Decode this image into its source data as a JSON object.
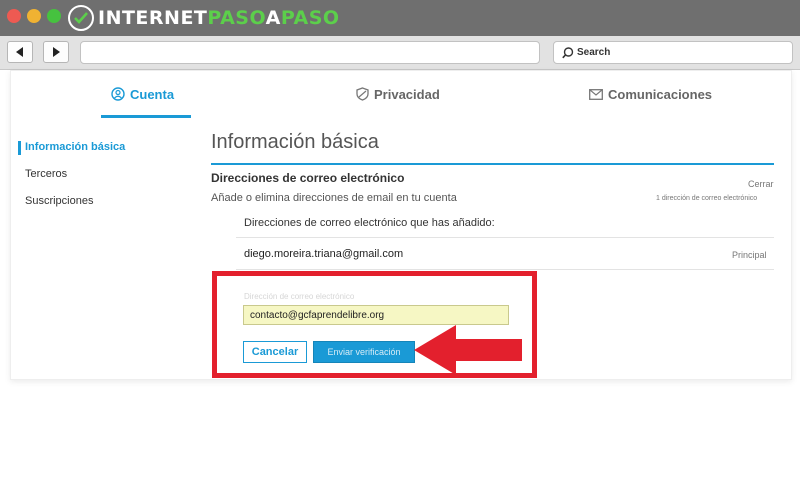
{
  "browser": {
    "logo": {
      "part1": "INTERNET",
      "part2": "PASO",
      "part3": "A",
      "part4": "PASO"
    },
    "search_placeholder": "Search"
  },
  "tabs": [
    {
      "label": "Cuenta",
      "icon": "user-circle-icon",
      "active": true
    },
    {
      "label": "Privacidad",
      "icon": "shield-icon",
      "active": false
    },
    {
      "label": "Comunicaciones",
      "icon": "envelope-icon",
      "active": false
    }
  ],
  "sidebar": {
    "items": [
      {
        "label": "Información básica",
        "active": true
      },
      {
        "label": "Terceros",
        "active": false
      },
      {
        "label": "Suscripciones",
        "active": false
      }
    ]
  },
  "main": {
    "title": "Información básica",
    "section": {
      "heading": "Direcciones de correo electrónico",
      "close_label": "Cerrar",
      "description": "Añade o elimina direcciones de email en tu cuenta",
      "count": "1 dirección de correo electrónico",
      "added_label": "Direcciones de correo electrónico que has añadido:",
      "emails": [
        {
          "address": "diego.moreira.triana@gmail.com",
          "tag": "Principal"
        }
      ],
      "new_email": {
        "label": "Dirección de correo electrónico",
        "value": "contacto@gcfaprendelibre.org"
      },
      "cancel_label": "Cancelar",
      "verify_label": "Enviar verificación"
    }
  },
  "colors": {
    "accent": "#1a9ad6",
    "annotation": "#e3202d",
    "logo_accent": "#5ccf4b",
    "input_highlight": "#f6f7c4"
  }
}
